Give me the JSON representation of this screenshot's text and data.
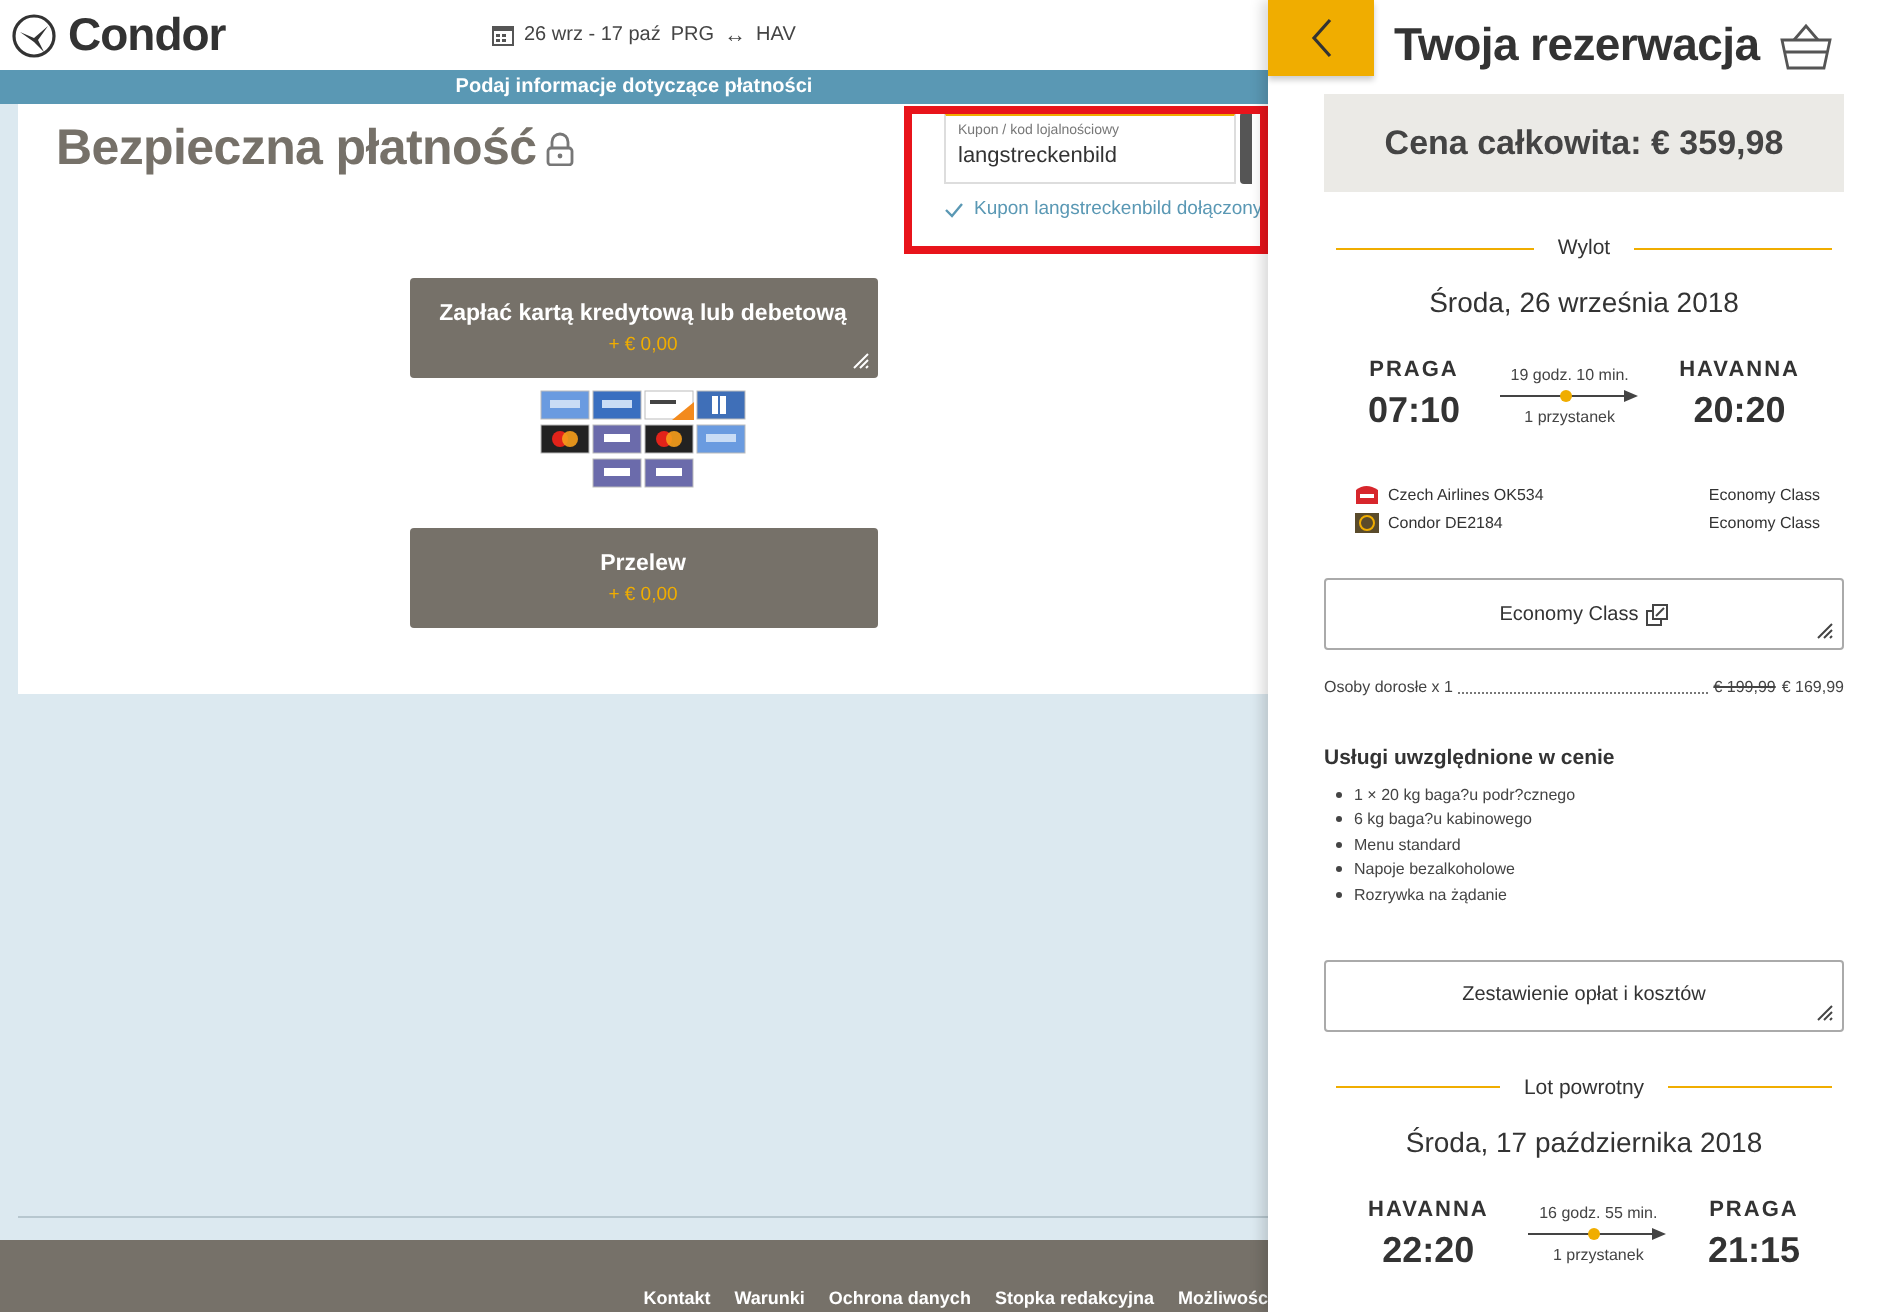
{
  "header": {
    "logo": "Condor",
    "dates": "26 wrz - 17 paź",
    "origin": "PRG",
    "arrow": "↔",
    "destination": "HAV"
  },
  "banner": "Podaj informacje dotyczące płatności",
  "payment": {
    "title": "Bezpieczna płatność",
    "coupon": {
      "label": "Kupon / kod lojalnościowy",
      "value": "langstreckenbild",
      "applied": true,
      "message": "Kupon langstreckenbild dołączony",
      "highlighted": true
    },
    "methods": [
      {
        "label": "Zapłać kartą kredytową lub debetową",
        "price": "+ € 0,00",
        "cards": true
      },
      {
        "label": "Przelew",
        "price": "+ € 0,00",
        "cards": false
      }
    ]
  },
  "footer": {
    "links": [
      "Kontakt",
      "Warunki",
      "Ochrona danych",
      "Stopka redakcyjna",
      "Możliwośc"
    ]
  },
  "booking": {
    "title": "Twoja rezerwacja",
    "total": "Cena całkowita: € 359,98",
    "outbound": {
      "heading": "Wylot",
      "date": "Środa, 26 września 2018",
      "from": "PRAGA",
      "dep": "07:10",
      "to": "HAVANNA",
      "arr": "20:20",
      "duration": "19 godz. 10 min.",
      "stops": "1 przystanek",
      "segments": [
        {
          "carrier": "Czech Airlines OK534",
          "cabin": "Economy Class",
          "kind": "csa"
        },
        {
          "carrier": "Condor DE2184",
          "cabin": "Economy Class",
          "kind": "condor"
        }
      ]
    },
    "fare_button": "Economy Class",
    "passengers": {
      "label": "Osoby dorosłe x 1",
      "old_price": "€ 199,99",
      "price": "€ 169,99"
    },
    "services_title": "Usługi uwzględnione w cenie",
    "services": [
      "1 × 20 kg baga?u podr?cznego",
      "6 kg baga?u kabinowego",
      "Menu standard",
      "Napoje bezalkoholowe",
      "Rozrywka na żądanie"
    ],
    "costs_button": "Zestawienie opłat i kosztów",
    "return": {
      "heading": "Lot powrotny",
      "date": "Środa, 17 października 2018",
      "from": "HAVANNA",
      "dep": "22:20",
      "to": "PRAGA",
      "arr": "21:15",
      "duration": "16 godz. 55 min.",
      "stops": "1 przystanek"
    }
  }
}
